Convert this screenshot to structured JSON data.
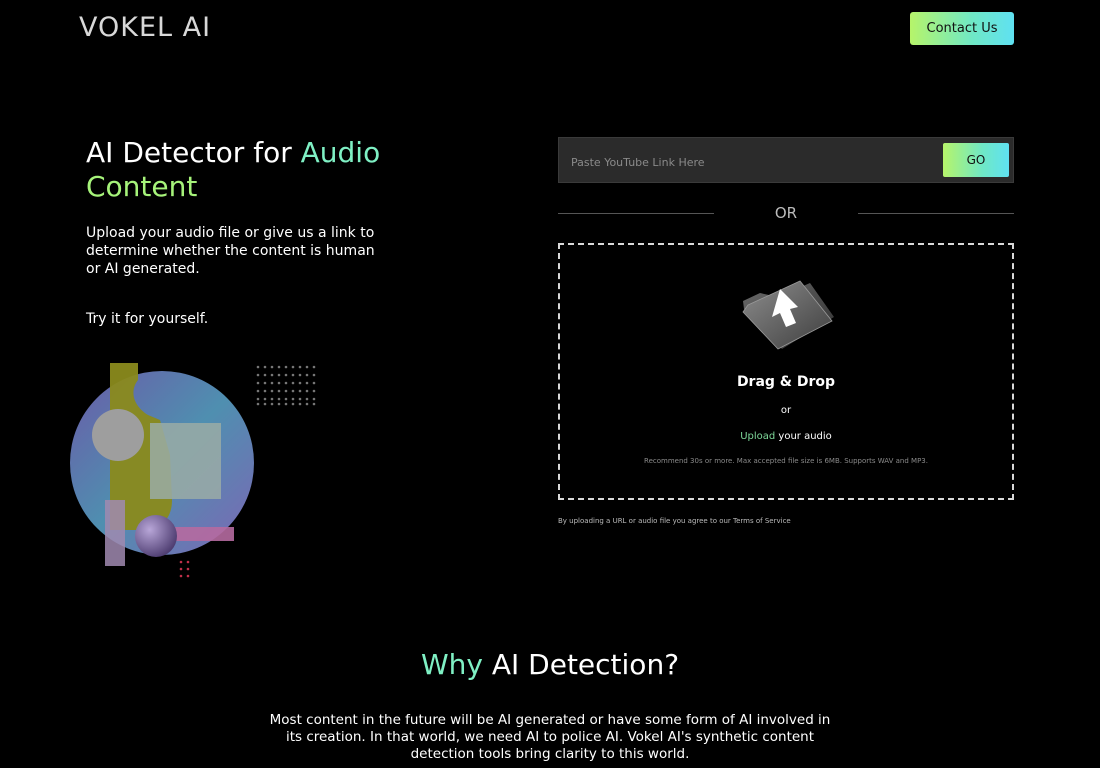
{
  "header": {
    "logo": "VOKEL AI",
    "contact_label": "Contact Us"
  },
  "hero": {
    "title_part1": "AI Detector for ",
    "title_accent1": "Audio",
    "title_accent2": "Content",
    "description": "Upload your audio file or give us a link to determine whether the content is human or AI generated.",
    "try_text": "Try it for yourself."
  },
  "url_form": {
    "placeholder": "Paste YouTube Link Here",
    "value": "",
    "go_label": "GO"
  },
  "divider": {
    "or_label": "OR"
  },
  "dropzone": {
    "title": "Drag & Drop",
    "or": "or",
    "upload_link": "Upload",
    "upload_suffix": " your audio",
    "note": "Recommend 30s or more. Max accepted file size is 6MB. Supports WAV and MP3."
  },
  "terms": "By uploading a URL or audio file you agree to our Terms of Service",
  "why": {
    "title_accent": "Why",
    "title_rest": " AI Detection?",
    "text": "Most content in the future will be AI generated or have some form of AI involved in its creation. In that world, we need AI to police AI. Vokel AI's synthetic content detection tools bring clarity to this world."
  },
  "colors": {
    "background": "#000000",
    "accent_teal": "#7ff0c4",
    "accent_green": "#a6f37a",
    "button_gradient_start": "#b6f46a",
    "button_gradient_end": "#5fe1f2",
    "upload_link": "#7ed99a"
  }
}
